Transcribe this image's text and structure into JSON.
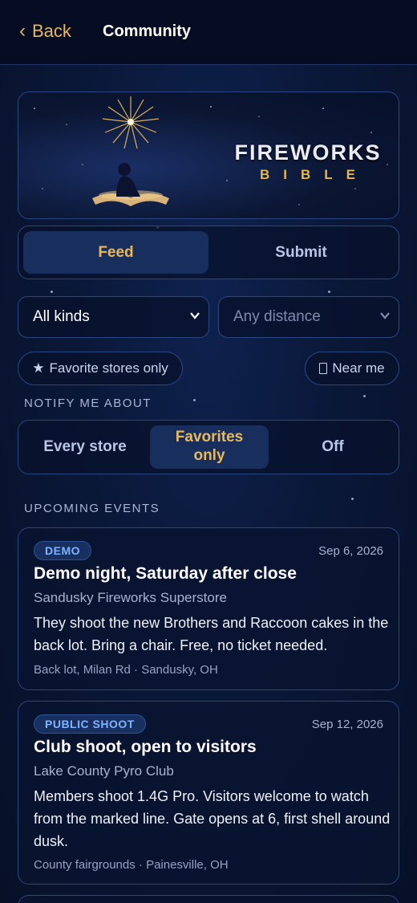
{
  "header": {
    "back_label": "Back",
    "title": "Community"
  },
  "banner": {
    "brand_line1": "FIREWORKS",
    "brand_line2": "BIBLE"
  },
  "tabs": {
    "items": [
      "Feed",
      "Submit"
    ],
    "active": "Feed"
  },
  "filters": {
    "kind_select": "All kinds",
    "distance_select": "Any distance",
    "favorite_chip": "Favorite stores only",
    "favorite_chip_icon": "star-icon",
    "near_chip": "Near me",
    "near_chip_icon": "location-icon"
  },
  "notify": {
    "label": "NOTIFY ME ABOUT",
    "options": [
      "Every store",
      "Favorites only",
      "Off"
    ],
    "active": "Favorites only"
  },
  "events": {
    "label": "UPCOMING EVENTS",
    "items": [
      {
        "badge": "DEMO",
        "date": "Sep 6, 2026",
        "title": "Demo night, Saturday after close",
        "organizer": "Sandusky Fireworks Superstore",
        "description": "They shoot the new Brothers and Raccoon cakes in the back lot. Bring a chair. Free, no ticket needed.",
        "location": "Back lot, Milan Rd · Sandusky, OH"
      },
      {
        "badge": "PUBLIC SHOOT",
        "date": "Sep 12, 2026",
        "title": "Club shoot, open to visitors",
        "organizer": "Lake County Pyro Club",
        "description": "Members shoot 1.4G Pro. Visitors welcome to watch from the marked line. Gate opens at 6, first shell around dusk.",
        "location": "County fairgrounds · Painesville, OH"
      }
    ]
  },
  "colors": {
    "accent": "#e8b95c",
    "badge_text": "#7fb3ff",
    "background": "#0a1838"
  }
}
